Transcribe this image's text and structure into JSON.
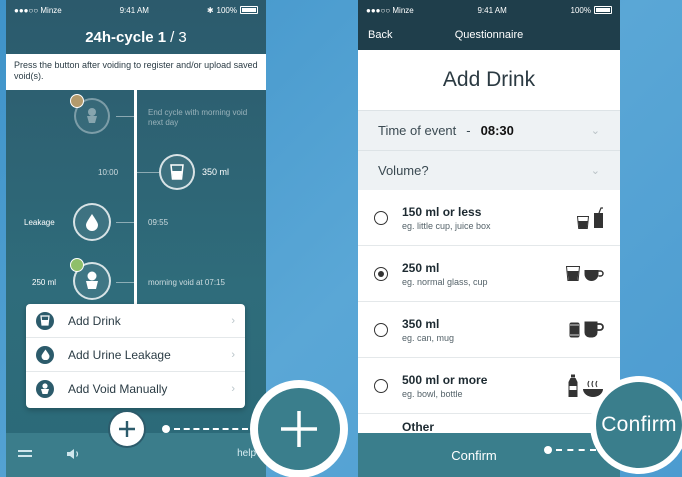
{
  "left_screen": {
    "status": {
      "carrier": "●●●○○ Minze",
      "time": "9:41 AM",
      "battery": "100%"
    },
    "header": {
      "title": "24h-cycle 1",
      "fraction": "/ 3"
    },
    "instruction": "Press the button after voiding to register and/or upload saved void(s).",
    "timeline": {
      "end_cycle_label": "End cycle with morning void next day",
      "time_1000": "10:00",
      "volume_350": "350 ml",
      "leakage_label": "Leakage",
      "time_0955": "09:55",
      "volume_250": "250 ml",
      "morning_void": "morning void at 07:15"
    },
    "menu": [
      {
        "label": "Add Drink",
        "icon": "cup-icon"
      },
      {
        "label": "Add Urine Leakage",
        "icon": "droplet-icon"
      },
      {
        "label": "Add Void Manually",
        "icon": "toilet-icon"
      }
    ],
    "footer": {
      "help": "help"
    }
  },
  "right_screen": {
    "status": {
      "carrier": "●●●○○ Minze",
      "time": "9:41 AM",
      "battery": "100%"
    },
    "nav": {
      "back": "Back",
      "title": "Questionnaire"
    },
    "page_title": "Add Drink",
    "time_of_event": {
      "label": "Time of event",
      "separator": "-",
      "value": "08:30"
    },
    "volume_prompt": "Volume?",
    "options": [
      {
        "main": "150 ml or less",
        "sub": "eg. little cup, juice box",
        "selected": false
      },
      {
        "main": "250 ml",
        "sub": "eg. normal glass, cup",
        "selected": true
      },
      {
        "main": "350 ml",
        "sub": "eg. can, mug",
        "selected": false
      },
      {
        "main": "500 ml or more",
        "sub": "eg. bowl, bottle",
        "selected": false
      }
    ],
    "partial_option": "Other",
    "footer": {
      "confirm": "Confirm"
    },
    "zoom_confirm": "Confirm"
  },
  "colors": {
    "background": "#4c9bd0",
    "teal_dark": "#1f3e4b",
    "teal": "#3a7e8c"
  }
}
